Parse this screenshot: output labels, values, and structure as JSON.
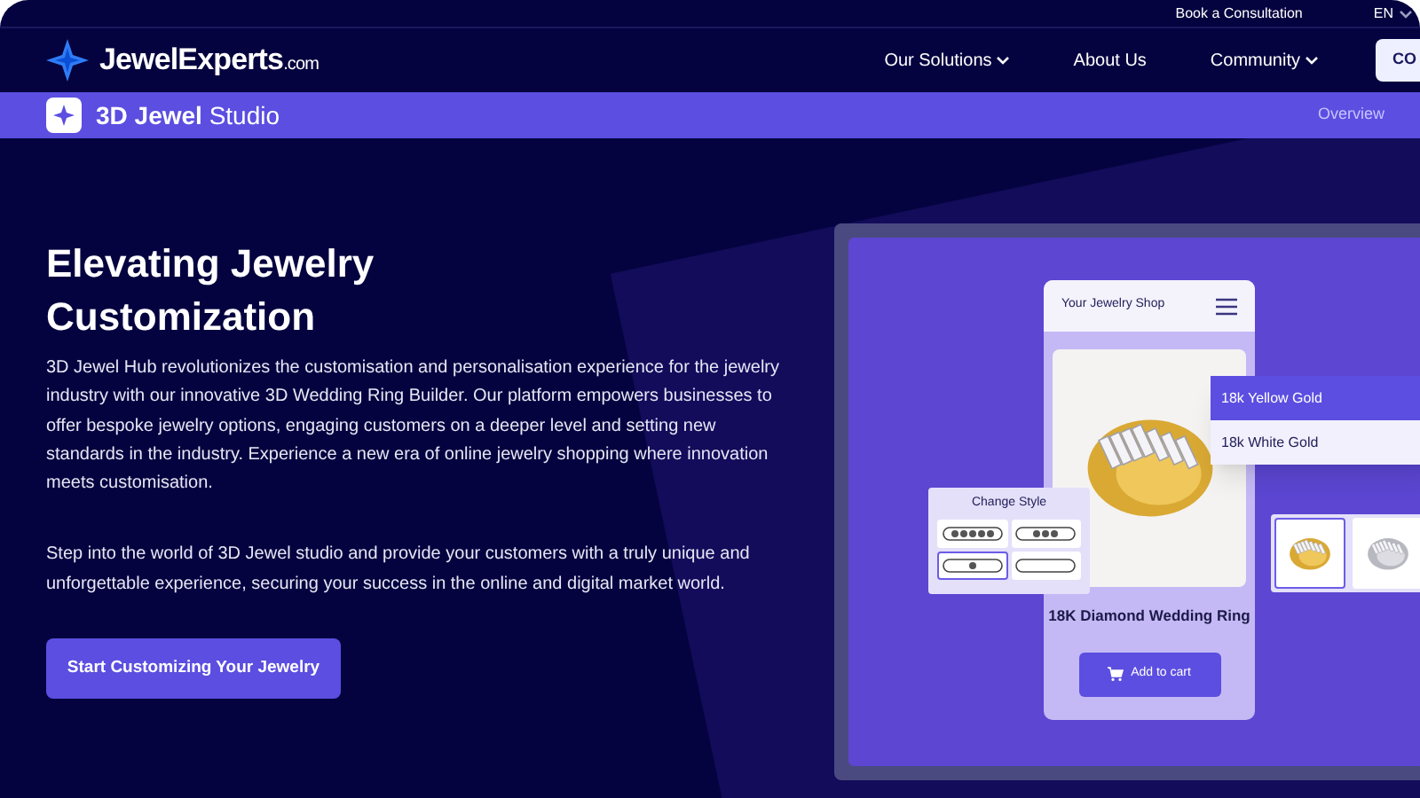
{
  "top_bar": {
    "link": "Book a Consultation",
    "language": "EN"
  },
  "nav": {
    "brand": "JewelExperts",
    "brand_suffix": ".com",
    "items": [
      {
        "label": "Our Solutions",
        "dropdown": true
      },
      {
        "label": "About Us",
        "dropdown": false
      },
      {
        "label": "Community",
        "dropdown": true
      }
    ],
    "cta": "CO"
  },
  "sub_bar": {
    "title_bold": "3D Jewel",
    "title": "Studio",
    "link": "Overview"
  },
  "hero": {
    "title": "Elevating Jewelry Customization",
    "paragraphs": [
      "3D Jewel Hub revolutionizes the customisation and personalisation experience for the jewelry industry with our innovative 3D Wedding Ring Builder. Our platform empowers businesses to offer bespoke jewelry options, engaging customers on a deeper level and setting new standards in the industry. Experience a new era of online jewelry shopping where innovation meets customisation.",
      "Step into the world of 3D Jewel studio and provide your customers with a truly unique and unforgettable experience, securing your success in the online and digital market world."
    ],
    "button": "Start Customizing Your Jewelry"
  },
  "mockup": {
    "shop_title": "Your Jewelry Shop",
    "options": [
      {
        "label": "18k Yellow Gold",
        "selected": true
      },
      {
        "label": "18k White Gold",
        "selected": false
      }
    ],
    "change_style": {
      "title": "Change Style",
      "styles": [
        {
          "kind": "five-stone",
          "selected": false
        },
        {
          "kind": "three-stone",
          "selected": false
        },
        {
          "kind": "solitaire",
          "selected": true
        },
        {
          "kind": "plain",
          "selected": false
        }
      ]
    },
    "thumbnails": [
      {
        "kind": "gold",
        "selected": true
      },
      {
        "kind": "white",
        "selected": false
      }
    ],
    "product_name": "18K Diamond Wedding Ring",
    "add_to_cart": "Add to cart"
  }
}
